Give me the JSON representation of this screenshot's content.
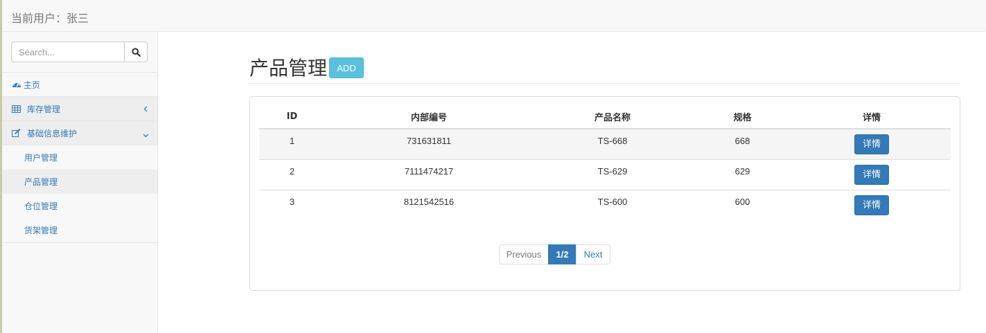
{
  "header": {
    "current_user": "当前用户：张三"
  },
  "search": {
    "placeholder": "Search..."
  },
  "sidebar": {
    "items": [
      {
        "label": "主页",
        "icon": "dashboard-icon"
      },
      {
        "label": "库存管理",
        "icon": "table-icon",
        "chevron": "chevron-left-icon"
      },
      {
        "label": "基础信息维护",
        "icon": "edit-icon",
        "chevron": "chevron-down-icon"
      }
    ],
    "sub_items": [
      "用户管理",
      "产品管理",
      "仓位管理",
      "货架管理"
    ],
    "active_sub_item": "产品管理"
  },
  "main": {
    "title": "产品管理",
    "add_label": "ADD",
    "table": {
      "headers": [
        "ID",
        "内部编号",
        "产品名称",
        "规格",
        "详情"
      ],
      "rows": [
        {
          "id": "1",
          "code": "731631811",
          "name": "TS-668",
          "spec": "668",
          "action": "详情"
        },
        {
          "id": "2",
          "code": "7111474217",
          "name": "TS-629",
          "spec": "629",
          "action": "详情"
        },
        {
          "id": "3",
          "code": "8121542516",
          "name": "TS-600",
          "spec": "600",
          "action": "详情"
        }
      ]
    },
    "pagination": {
      "previous": "Previous",
      "current": "1/2",
      "next": "Next"
    }
  },
  "colors": {
    "primary": "#337ab7",
    "info": "#5bc0de",
    "link": "#337ab7"
  }
}
